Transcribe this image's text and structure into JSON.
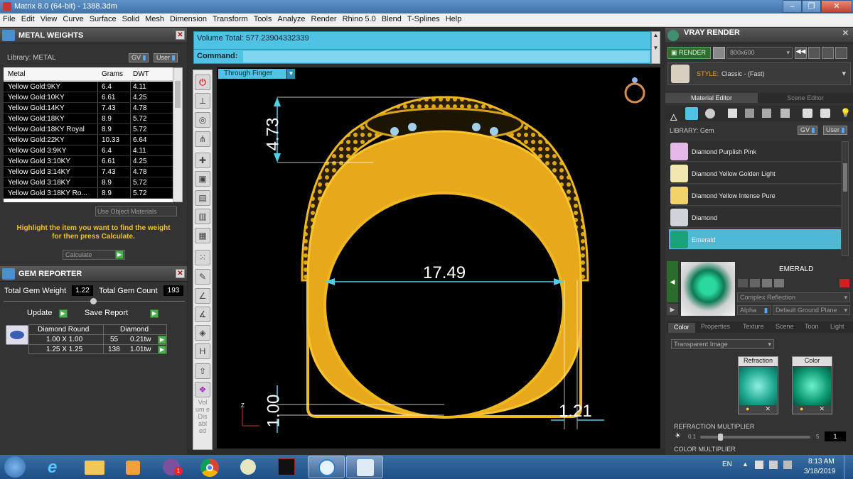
{
  "window": {
    "title": "Matrix 8.0 (64-bit) - 1388.3dm",
    "min": "–",
    "max": "❐",
    "close": "✕"
  },
  "menu": [
    "File",
    "Edit",
    "View",
    "Curve",
    "Surface",
    "Solid",
    "Mesh",
    "Dimension",
    "Transform",
    "Tools",
    "Analyze",
    "Render",
    "Rhino 5.0",
    "Blend",
    "T-Splines",
    "Help"
  ],
  "metal_weights": {
    "title": "METAL WEIGHTS",
    "library_label": "Library: METAL",
    "gv": "GV",
    "user": "User",
    "columns": [
      "Metal",
      "Grams",
      "DWT"
    ],
    "rows": [
      [
        "Yellow Gold:9KY",
        "6.4",
        "4.11"
      ],
      [
        "Yellow Gold:10KY",
        "6.61",
        "4.25"
      ],
      [
        "Yellow Gold:14KY",
        "7.43",
        "4.78"
      ],
      [
        "Yellow Gold:18KY",
        "8.9",
        "5.72"
      ],
      [
        "Yellow Gold:18KY Royal",
        "8.9",
        "5.72"
      ],
      [
        "Yellow Gold:22KY",
        "10.33",
        "6.64"
      ],
      [
        "Yellow Gold 3:9KY",
        "6.4",
        "4.11"
      ],
      [
        "Yellow Gold 3:10KY",
        "6.61",
        "4.25"
      ],
      [
        "Yellow Gold 3:14KY",
        "7.43",
        "4.78"
      ],
      [
        "Yellow Gold 3:18KY",
        "8.9",
        "5.72"
      ],
      [
        "Yellow Gold 3:18KY Ro...",
        "8.9",
        "5.72"
      ]
    ],
    "use_object_materials": "Use Object Materials",
    "hint_line1": "Highlight the item you want to find the weight",
    "hint_line2": "for then press Calculate.",
    "calculate": "Calculate"
  },
  "gem_reporter": {
    "title": "GEM REPORTER",
    "total_weight_label": "Total Gem Weight",
    "total_weight": "1.22",
    "total_count_label": "Total Gem Count",
    "total_count": "193",
    "update": "Update",
    "save_report": "Save Report",
    "col1": "Diamond Round",
    "col2": "Diamond",
    "rows": [
      [
        "1.00 X 1.00",
        "55",
        "0.21tw"
      ],
      [
        "1.25 X 1.25",
        "138",
        "1.01tw"
      ]
    ]
  },
  "command": {
    "volume": "Volume Total: 577.23904332339",
    "command_label": "Command:"
  },
  "side_label": "Vol um e Dis abl ed",
  "viewport": {
    "view_name": "Through Finger",
    "dims": {
      "top": "4.73",
      "width": "17.49",
      "bottom_left": "1.00",
      "bottom_right": "1.21"
    },
    "axis": "Z"
  },
  "vray": {
    "title": "VRAY RENDER",
    "render": "RENDER",
    "resolution": "800x600",
    "style_label": "STYLE:",
    "style_value": "Classic - (Fast)",
    "tabs": [
      "Material Editor",
      "Scene Editor"
    ],
    "library_label": "LIBRARY: Gem",
    "gv": "GV",
    "user": "User",
    "items": [
      {
        "label": "Diamond Purplish Pink",
        "color": "#e6b8e8"
      },
      {
        "label": "Diamond Yellow Golden Light",
        "color": "#f1e7b0"
      },
      {
        "label": "Diamond Yellow Intense Pure",
        "color": "#f3d26a"
      },
      {
        "label": "Diamond",
        "color": "#cfd4da"
      },
      {
        "label": "Emerald",
        "color": "#1aa37a"
      }
    ],
    "selected_name": "EMERALD",
    "reflection": "Complex Reflection",
    "alpha_label": "Alpha",
    "ground": "Default Ground Plane",
    "subtabs": [
      "Color",
      "Properties",
      "Texture",
      "Scene",
      "Toon",
      "Light"
    ],
    "transparent": "Transparent Image",
    "refraction_label": "Refraction",
    "color_label": "Color",
    "refraction_multiplier": "REFRACTION MULTIPLIER",
    "rm_min": "0.1",
    "rm_max": "5",
    "rm_value": "1",
    "color_multiplier": "COLOR MULTIPLIER"
  },
  "taskbar": {
    "lang": "EN",
    "time": "8:13 AM",
    "date": "3/18/2019",
    "badge": "1"
  }
}
